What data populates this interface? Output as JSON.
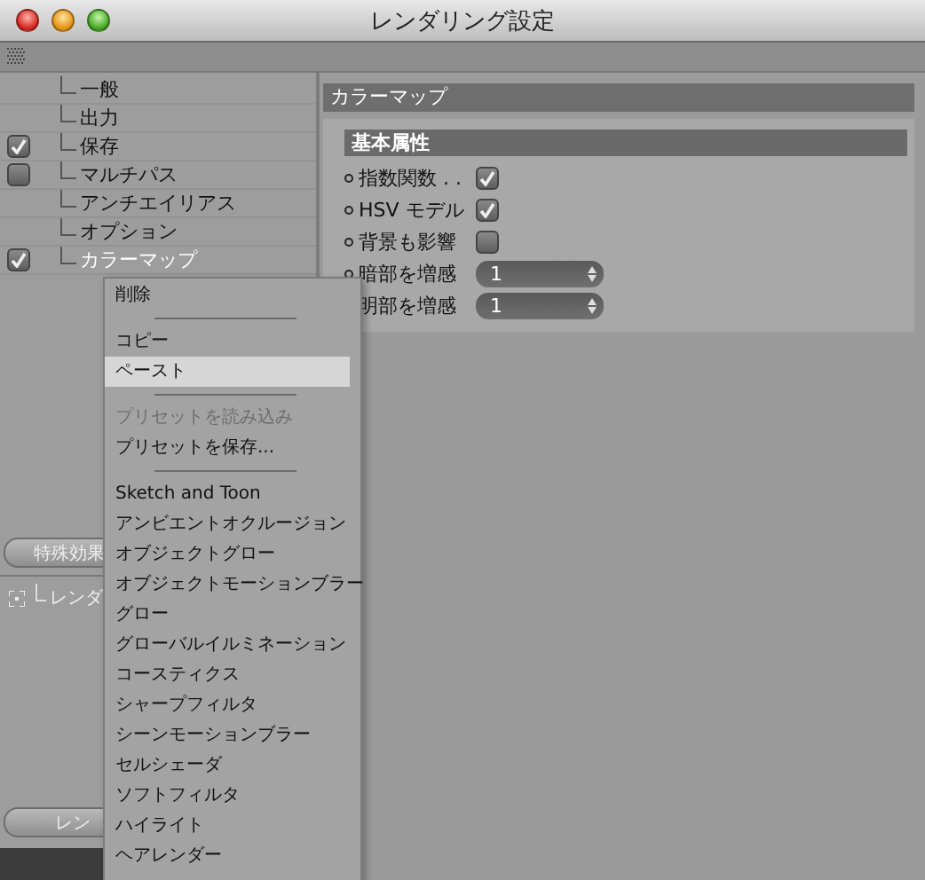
{
  "window": {
    "title": "レンダリング設定"
  },
  "tree": [
    {
      "label": "一般",
      "kind": "plain",
      "selected": false
    },
    {
      "label": "出力",
      "kind": "plain",
      "selected": false
    },
    {
      "label": "保存",
      "kind": "toggle",
      "checked": true,
      "selected": false
    },
    {
      "label": "マルチパス",
      "kind": "toggle",
      "checked": false,
      "selected": false
    },
    {
      "label": "アンチエイリアス",
      "kind": "plain",
      "selected": false
    },
    {
      "label": "オプション",
      "kind": "plain",
      "selected": false
    },
    {
      "label": "カラーマップ",
      "kind": "toggle",
      "checked": true,
      "selected": true
    }
  ],
  "effects_button": "特殊効果",
  "render_tree": [
    {
      "label": "レンダ"
    }
  ],
  "render_button": "レン",
  "panel": {
    "title": "カラーマップ",
    "section": "基本属性",
    "rows": [
      {
        "label": "指数関数 . .",
        "kind": "checkbox",
        "checked": true
      },
      {
        "label": "HSV モデル",
        "kind": "checkbox",
        "checked": true
      },
      {
        "label": "背景も影響",
        "kind": "checkbox",
        "checked": false
      },
      {
        "label": "暗部を増感",
        "kind": "number",
        "value": "1"
      },
      {
        "label": "明部を増感",
        "kind": "number",
        "value": "1"
      }
    ]
  },
  "menu": [
    {
      "kind": "item",
      "label": "削除",
      "selected": false,
      "disabled": false
    },
    {
      "kind": "separator"
    },
    {
      "kind": "item",
      "label": "コピー",
      "selected": false,
      "disabled": false
    },
    {
      "kind": "item",
      "label": "ペースト",
      "selected": true,
      "disabled": false
    },
    {
      "kind": "separator"
    },
    {
      "kind": "item",
      "label": "プリセットを読み込み",
      "selected": false,
      "disabled": true
    },
    {
      "kind": "item",
      "label": "プリセットを保存...",
      "selected": false,
      "disabled": false
    },
    {
      "kind": "separator"
    },
    {
      "kind": "item",
      "label": "Sketch and Toon",
      "selected": false,
      "disabled": false
    },
    {
      "kind": "item",
      "label": "アンビエントオクルージョン",
      "selected": false,
      "disabled": false
    },
    {
      "kind": "item",
      "label": "オブジェクトグロー",
      "selected": false,
      "disabled": false
    },
    {
      "kind": "item",
      "label": "オブジェクトモーションブラー",
      "selected": false,
      "disabled": false
    },
    {
      "kind": "item",
      "label": "グロー",
      "selected": false,
      "disabled": false
    },
    {
      "kind": "item",
      "label": "グローバルイルミネーション",
      "selected": false,
      "disabled": false
    },
    {
      "kind": "item",
      "label": "コースティクス",
      "selected": false,
      "disabled": false
    },
    {
      "kind": "item",
      "label": "シャープフィルタ",
      "selected": false,
      "disabled": false
    },
    {
      "kind": "item",
      "label": "シーンモーションブラー",
      "selected": false,
      "disabled": false
    },
    {
      "kind": "item",
      "label": "セルシェーダ",
      "selected": false,
      "disabled": false
    },
    {
      "kind": "item",
      "label": "ソフトフィルタ",
      "selected": false,
      "disabled": false
    },
    {
      "kind": "item",
      "label": "ハイライト",
      "selected": false,
      "disabled": false
    },
    {
      "kind": "item",
      "label": "ヘアレンダー",
      "selected": false,
      "disabled": false
    }
  ]
}
